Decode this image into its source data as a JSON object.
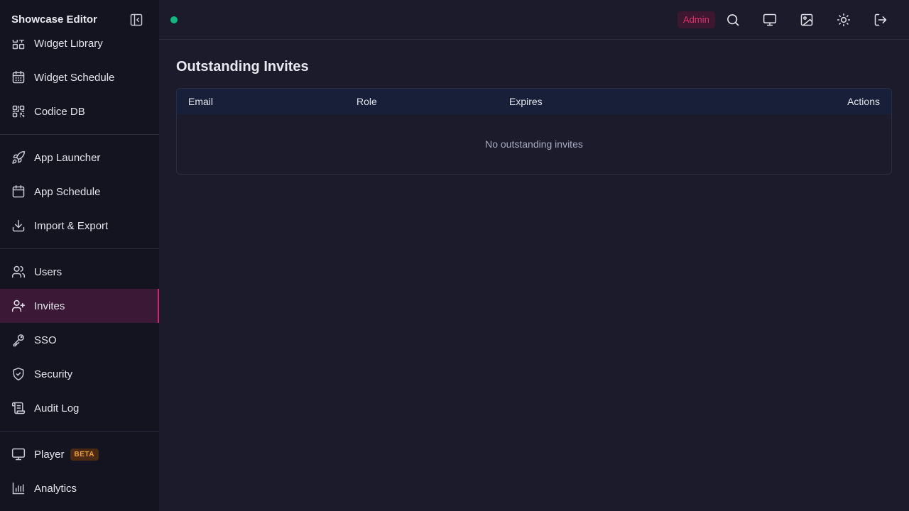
{
  "app": {
    "title": "Showcase Editor"
  },
  "sidebar": {
    "groups": [
      [
        {
          "label": "Widget Library",
          "icon": "grid-plus-icon"
        },
        {
          "label": "Widget Schedule",
          "icon": "calendar-icon"
        },
        {
          "label": "Codice DB",
          "icon": "qr-code-icon"
        }
      ],
      [
        {
          "label": "App Launcher",
          "icon": "rocket-icon"
        },
        {
          "label": "App Schedule",
          "icon": "calendar-icon"
        },
        {
          "label": "Import & Export",
          "icon": "download-icon"
        }
      ],
      [
        {
          "label": "Users",
          "icon": "users-icon"
        },
        {
          "label": "Invites",
          "icon": "user-plus-icon",
          "active": true
        },
        {
          "label": "SSO",
          "icon": "key-icon"
        },
        {
          "label": "Security",
          "icon": "shield-check-icon"
        },
        {
          "label": "Audit Log",
          "icon": "scroll-icon"
        }
      ],
      [
        {
          "label": "Player",
          "icon": "monitor-icon",
          "badge": "BETA"
        },
        {
          "label": "Analytics",
          "icon": "bar-chart-icon"
        }
      ]
    ]
  },
  "header": {
    "status_color": "#10b981",
    "role_badge": "Admin",
    "actions": [
      "search-icon",
      "monitor-icon",
      "image-icon",
      "sun-icon",
      "logout-icon"
    ]
  },
  "main": {
    "title": "Outstanding Invites",
    "table": {
      "columns": [
        "Email",
        "Role",
        "Expires",
        "Actions"
      ],
      "empty_text": "No outstanding invites"
    }
  },
  "colors": {
    "accent": "#d6246e",
    "active_bg": "#3b1835",
    "sidebar_bg": "#141420",
    "page_bg": "#1b1b2b",
    "table_header_bg": "#172038"
  }
}
